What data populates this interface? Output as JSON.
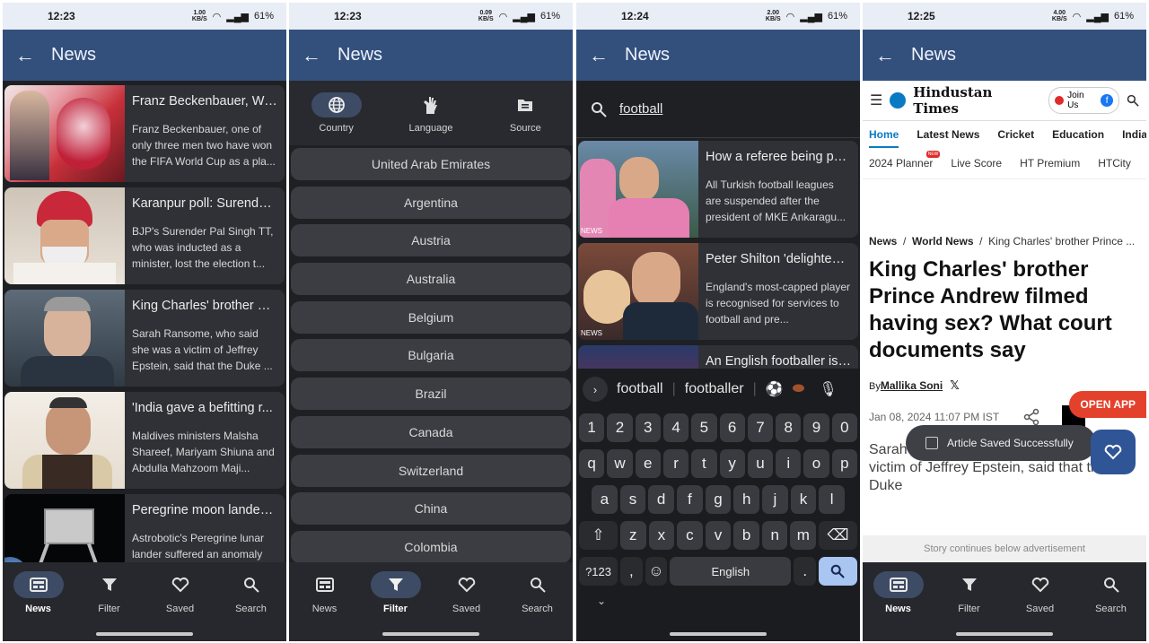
{
  "status": {
    "screen1": {
      "time": "12:23",
      "kbs": "1.00",
      "battery": "61%"
    },
    "screen2": {
      "time": "12:23",
      "kbs": "0.09",
      "battery": "61%"
    },
    "screen3": {
      "time": "12:24",
      "kbs": "2.00",
      "battery": "61%"
    },
    "screen4": {
      "time": "12:25",
      "kbs": "4.00",
      "battery": "61%"
    },
    "kbs_unit": "KB/S"
  },
  "appbar": {
    "title": "News"
  },
  "news": [
    {
      "title": "Franz Beckenbauer, Wo...",
      "desc": "Franz Beckenbauer, one of only three men two have won the FIFA World Cup as a pla..."
    },
    {
      "title": "Karanpur poll: Surender...",
      "desc": "BJP's Surender Pal Singh TT, who was inducted as a minister, lost the election t..."
    },
    {
      "title": "King Charles' brother Pr...",
      "desc": "Sarah Ransome, who said she was a victim of Jeffrey Epstein, said that the Duke ..."
    },
    {
      "title": "'India gave a befitting r...",
      "desc": "Maldives ministers Malsha Shareef, Mariyam Shiuna and Abdulla Mahzoom Maji..."
    },
    {
      "title": "Peregrine moon lander ...",
      "desc": "Astrobotic's Peregrine lunar lander suffered an anomaly"
    }
  ],
  "bottom_nav": [
    "News",
    "Filter",
    "Saved",
    "Search"
  ],
  "filter_tabs": [
    "Country",
    "Language",
    "Source"
  ],
  "countries": [
    "United Arab Emirates",
    "Argentina",
    "Austria",
    "Australia",
    "Belgium",
    "Bulgaria",
    "Brazil",
    "Canada",
    "Switzerland",
    "China",
    "Colombia"
  ],
  "search": {
    "query": "football",
    "results": [
      {
        "title": "How a referee being pu...",
        "desc": "All Turkish football leagues are suspended after the president of MKE Ankaragu..."
      },
      {
        "title": "Peter Shilton 'delighted'...",
        "desc": "England's most-capped player is recognised for services to football and pre..."
      },
      {
        "title": "An English footballer is ...",
        "desc": ""
      }
    ],
    "thumb_badge": "NEWS"
  },
  "keyboard": {
    "suggestions": [
      "football",
      "footballer"
    ],
    "row1": [
      "1",
      "2",
      "3",
      "4",
      "5",
      "6",
      "7",
      "8",
      "9",
      "0"
    ],
    "row2": [
      "q",
      "w",
      "e",
      "r",
      "t",
      "y",
      "u",
      "i",
      "o",
      "p"
    ],
    "row3": [
      "a",
      "s",
      "d",
      "f",
      "g",
      "h",
      "j",
      "k",
      "l"
    ],
    "row4": [
      "z",
      "x",
      "c",
      "v",
      "b",
      "n",
      "m"
    ],
    "sym": "?123",
    "comma": ",",
    "space": "English",
    "period": "."
  },
  "web": {
    "logo": "Hindustan Times",
    "join": "Join Us",
    "nav": [
      "Home",
      "Latest News",
      "Cricket",
      "Education",
      "India"
    ],
    "nav2": [
      "2024 Planner",
      "Live Score",
      "HT Premium",
      "HTCity"
    ],
    "new_badge": "NEW",
    "crumbs": [
      "News",
      "World News",
      "King Charles' brother Prince ..."
    ],
    "headline": "King Charles' brother Prince Andrew filmed having sex? What court documents say",
    "by": "By",
    "author": "Mallika Soni",
    "date": "Jan 08, 2024 11:07 PM IST",
    "excerpt": "Sarah Ransome, who said she was a victim of Jeffrey Epstein, said that the Duke",
    "ad": "Story continues below advertisement",
    "open_app": "OPEN APP",
    "toast": "Article Saved Successfully"
  }
}
